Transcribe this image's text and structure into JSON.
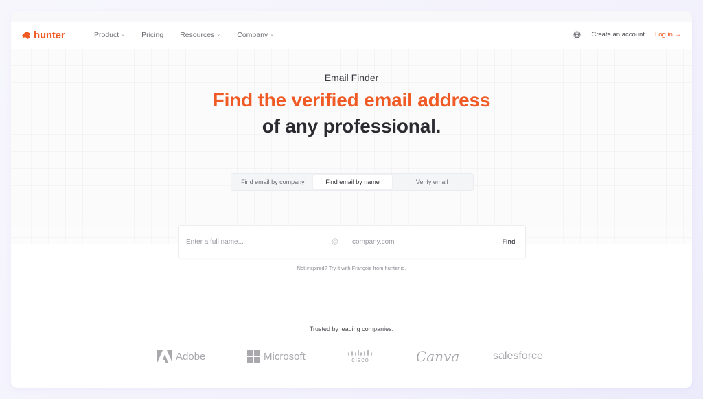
{
  "brand": {
    "name": "hunter",
    "accent_color": "#f05a24"
  },
  "nav": {
    "items": [
      {
        "label": "Product",
        "has_dropdown": true
      },
      {
        "label": "Pricing",
        "has_dropdown": false
      },
      {
        "label": "Resources",
        "has_dropdown": true
      },
      {
        "label": "Company",
        "has_dropdown": true
      }
    ],
    "dropdown_glyph": "⌄",
    "language_icon": "globe-icon",
    "create_account": "Create an account",
    "login": "Log in →"
  },
  "hero": {
    "eyebrow": "Email Finder",
    "headline": "Find the verified email address",
    "subheadline": "of any professional."
  },
  "tabs": [
    {
      "label": "Find email by company",
      "active": false
    },
    {
      "label": "Find email by name",
      "active": true
    },
    {
      "label": "Verify email",
      "active": false
    }
  ],
  "search": {
    "name_placeholder": "Enter a full name...",
    "name_value": "",
    "at_symbol": "@",
    "domain_placeholder": "company.com",
    "domain_value": "",
    "find_label": "Find"
  },
  "hint": {
    "prefix": "Not inspired? Try it with ",
    "link": "François from hunter.io",
    "suffix": "."
  },
  "trusted": {
    "title": "Trusted by leading companies.",
    "logos": [
      "Adobe",
      "Microsoft",
      "cisco",
      "Canva",
      "salesforce"
    ]
  }
}
